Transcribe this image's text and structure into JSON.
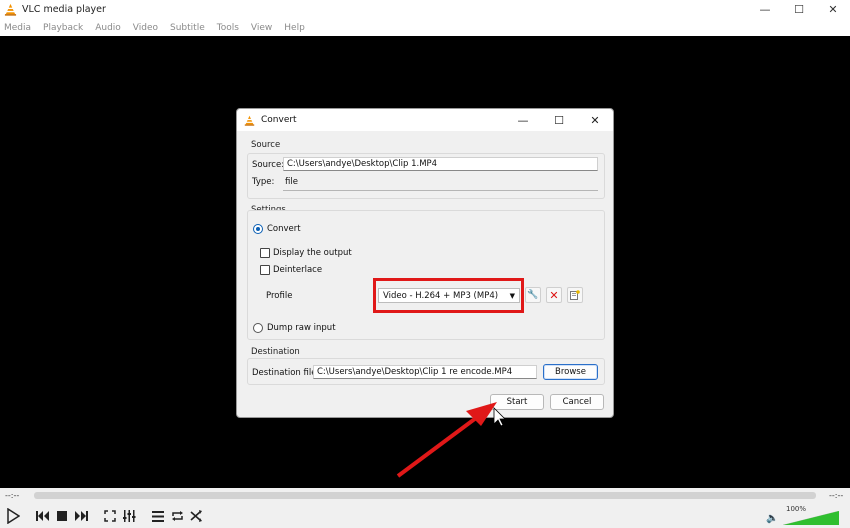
{
  "app": {
    "title": "VLC media player",
    "window_controls": {
      "minimize": "—",
      "maximize": "☐",
      "close": "✕"
    }
  },
  "menu": [
    "Media",
    "Playback",
    "Audio",
    "Video",
    "Subtitle",
    "Tools",
    "View",
    "Help"
  ],
  "dialog": {
    "title": "Convert",
    "source": {
      "group_label": "Source",
      "source_label": "Source:",
      "source_value": "C:\\Users\\andye\\Desktop\\Clip 1.MP4",
      "type_label": "Type:",
      "type_value": "file"
    },
    "settings": {
      "group_label": "Settings",
      "convert_label": "Convert",
      "convert_selected": true,
      "display_output_label": "Display the output",
      "deinterlace_label": "Deinterlace",
      "profile_label": "Profile",
      "profile_value": "Video - H.264 + MP3 (MP4)",
      "dump_raw_label": "Dump raw input"
    },
    "destination": {
      "group_label": "Destination",
      "file_label": "Destination file:",
      "file_value": "C:\\Users\\andye\\Desktop\\Clip 1 re encode.MP4",
      "browse_label": "Browse"
    },
    "start_label": "Start",
    "cancel_label": "Cancel"
  },
  "player": {
    "time_elapsed": "--:--",
    "time_total": "--:--",
    "volume_label": "100%"
  },
  "colors": {
    "highlight": "#e01818",
    "accent": "#0b5fb4",
    "volume": "#2fbf2f"
  },
  "icons": {
    "app": "vlc-cone-icon",
    "profile_edit": "wrench-icon",
    "profile_delete": "red-x-icon",
    "profile_new": "new-profile-icon"
  }
}
